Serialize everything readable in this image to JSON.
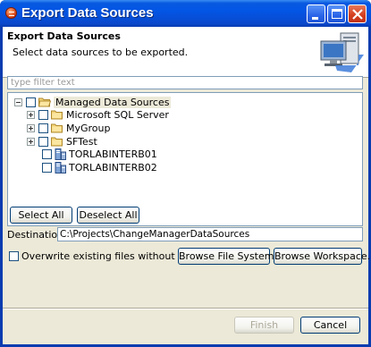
{
  "window": {
    "title": "Export Data Sources"
  },
  "banner": {
    "title": "Export Data Sources",
    "description": "Select data sources to be exported."
  },
  "filter": {
    "placeholder": "type filter text"
  },
  "tree": {
    "root": {
      "label": "Managed Data Sources",
      "expanded": true,
      "checked": false
    },
    "children": [
      {
        "label": "Microsoft SQL Server",
        "type": "folder",
        "expandable": true,
        "checked": false
      },
      {
        "label": "MyGroup",
        "type": "folder",
        "expandable": true,
        "checked": false
      },
      {
        "label": "SFTest",
        "type": "folder",
        "expandable": true,
        "checked": false
      },
      {
        "label": "TORLABINTERB01",
        "type": "server",
        "expandable": false,
        "checked": false
      },
      {
        "label": "TORLABINTERB02",
        "type": "server",
        "expandable": false,
        "checked": false
      }
    ]
  },
  "buttons": {
    "select_all": "Select All",
    "deselect_all": "Deselect All",
    "browse_file_system": "Browse File System...",
    "browse_workspace": "Browse Workspace...",
    "finish": "Finish",
    "cancel": "Cancel"
  },
  "destination": {
    "label": "Destination:",
    "value": "C:\\Projects\\ChangeManagerDataSources"
  },
  "overwrite": {
    "label": "Overwrite existing files without warning",
    "checked": false
  },
  "colors": {
    "titlebar": "#0356e5",
    "dialog_bg": "#ece9d8",
    "close_button": "#d23d1d"
  },
  "icons": {
    "app": "app-icon",
    "minimize": "minimize-icon",
    "maximize": "maximize-icon",
    "close": "close-icon",
    "banner": "export-computer-icon",
    "folder": "folder-icon",
    "server": "server-icon"
  }
}
